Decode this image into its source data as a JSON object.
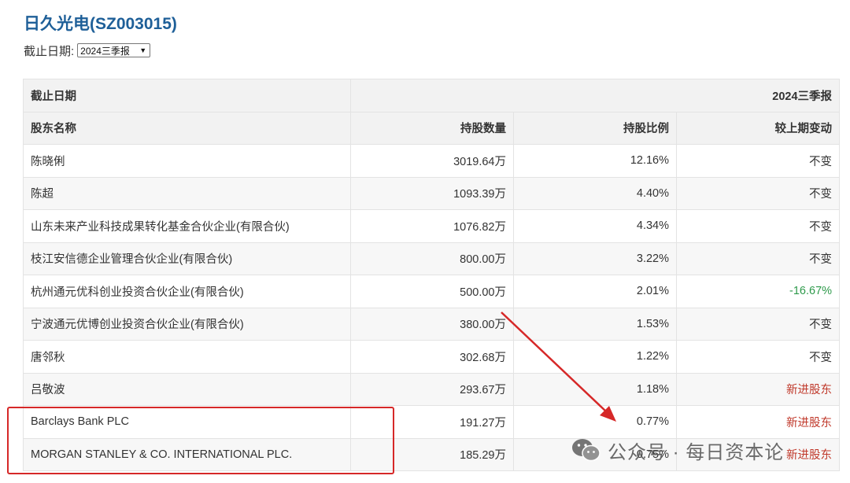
{
  "page": {
    "title": "日久光电(SZ003015)",
    "filter_label": "截止日期:",
    "filter_value": "2024三季报"
  },
  "table": {
    "period_header_label": "截止日期",
    "period_header_value": "2024三季报",
    "columns": [
      "股东名称",
      "持股数量",
      "持股比例",
      "较上期变动"
    ],
    "rows": [
      {
        "name": "陈晓俐",
        "shares": "3019.64万",
        "ratio": "12.16%",
        "change": "不变",
        "change_type": "unchanged"
      },
      {
        "name": "陈超",
        "shares": "1093.39万",
        "ratio": "4.40%",
        "change": "不变",
        "change_type": "unchanged"
      },
      {
        "name": "山东未来产业科技成果转化基金合伙企业(有限合伙)",
        "shares": "1076.82万",
        "ratio": "4.34%",
        "change": "不变",
        "change_type": "unchanged"
      },
      {
        "name": "枝江安信德企业管理合伙企业(有限合伙)",
        "shares": "800.00万",
        "ratio": "3.22%",
        "change": "不变",
        "change_type": "unchanged"
      },
      {
        "name": "杭州通元优科创业投资合伙企业(有限合伙)",
        "shares": "500.00万",
        "ratio": "2.01%",
        "change": "-16.67%",
        "change_type": "decrease"
      },
      {
        "name": "宁波通元优博创业投资合伙企业(有限合伙)",
        "shares": "380.00万",
        "ratio": "1.53%",
        "change": "不变",
        "change_type": "unchanged"
      },
      {
        "name": "唐邻秋",
        "shares": "302.68万",
        "ratio": "1.22%",
        "change": "不变",
        "change_type": "unchanged"
      },
      {
        "name": "吕敬波",
        "shares": "293.67万",
        "ratio": "1.18%",
        "change": "新进股东",
        "change_type": "new"
      },
      {
        "name": "Barclays Bank PLC",
        "shares": "191.27万",
        "ratio": "0.77%",
        "change": "新进股东",
        "change_type": "new"
      },
      {
        "name": "MORGAN STANLEY & CO. INTERNATIONAL PLC.",
        "shares": "185.29万",
        "ratio": "0.75%",
        "change": "新进股东",
        "change_type": "new"
      }
    ]
  },
  "watermark": {
    "text": "公众号 · 每日资本论",
    "icon": "wechat-icon"
  },
  "colors": {
    "title": "#1e5f98",
    "decrease": "#2e9a4b",
    "new_holder": "#c0392b",
    "annotation": "#d62828"
  }
}
